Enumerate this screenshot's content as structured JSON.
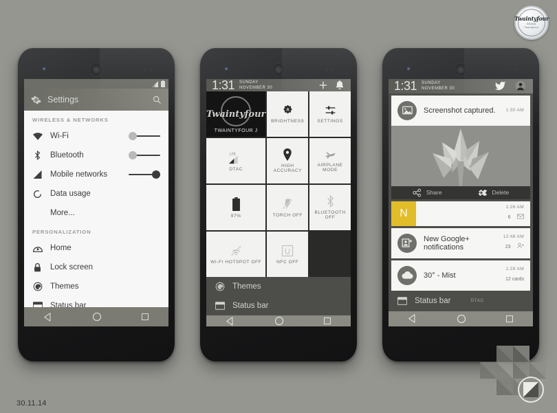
{
  "background_color": "#969691",
  "date_caption": "30.11.14",
  "brand_badge": {
    "word": "Twaintyfour",
    "sub_line1": "BRAND",
    "sub_line2": "Twaintyfour"
  },
  "corner_logo": {
    "name": "octagon-logo",
    "badge_name": "circle-slash-badge"
  },
  "phone1": {
    "name": "settings-app",
    "statusbar": {
      "signal_icon": "signal-icon",
      "battery_icon": "battery-icon"
    },
    "header": {
      "title": "Settings",
      "gear_icon": "gear-icon",
      "search_icon": "search-icon"
    },
    "sections": [
      {
        "label": "WIRELESS & NETWORKS",
        "rows": [
          {
            "icon": "wifi-icon",
            "label": "Wi-Fi",
            "toggle": "off"
          },
          {
            "icon": "bluetooth-icon",
            "label": "Bluetooth",
            "toggle": "off"
          },
          {
            "icon": "signal-icon",
            "label": "Mobile networks",
            "toggle": "on"
          },
          {
            "icon": "data-usage-icon",
            "label": "Data usage",
            "toggle": "none"
          },
          {
            "icon": "",
            "label": "More...",
            "toggle": "none"
          }
        ]
      },
      {
        "label": "PERSONALIZATION",
        "rows": [
          {
            "icon": "home-icon",
            "label": "Home",
            "toggle": "none"
          },
          {
            "icon": "lock-icon",
            "label": "Lock screen",
            "toggle": "none"
          },
          {
            "icon": "themes-icon",
            "label": "Themes",
            "toggle": "none"
          },
          {
            "icon": "status-bar-icon",
            "label": "Status bar",
            "toggle": "none"
          }
        ]
      }
    ],
    "navbar": {
      "back": "back-icon",
      "home": "home-circle-icon",
      "recents": "recents-icon"
    }
  },
  "phone2": {
    "name": "quick-settings-panel",
    "statusbar": {
      "time": "1:31",
      "date_line1": "SUNDAY",
      "date_line2": "NOVEMBER 30",
      "add_icon": "plus-icon",
      "bell_icon": "bell-icon"
    },
    "tiles": [
      {
        "kind": "user",
        "icon": "user-avatar-logo",
        "label": "TWAINTYFOUR J",
        "logo_word": "Twaintyfour"
      },
      {
        "kind": "tile",
        "icon": "brightness-auto-icon",
        "label": "BRIGHTNESS"
      },
      {
        "kind": "tile",
        "icon": "sliders-icon",
        "label": "SETTINGS"
      },
      {
        "kind": "tile",
        "icon": "lte-signal-icon",
        "label": "DTAC",
        "badge": "LTE"
      },
      {
        "kind": "tile",
        "icon": "location-pin-icon",
        "label": "HIGH ACCURACY"
      },
      {
        "kind": "tile",
        "icon": "airplane-icon",
        "label": "AIRPLANE MODE"
      },
      {
        "kind": "tile",
        "icon": "battery-full-icon",
        "label": "97%"
      },
      {
        "kind": "tile",
        "icon": "torch-off-icon",
        "label": "TORCH OFF"
      },
      {
        "kind": "tile",
        "icon": "bluetooth-off-icon",
        "label": "BLUETOOTH OFF"
      },
      {
        "kind": "tile",
        "icon": "hotspot-off-icon",
        "label": "WI-FI HOTSPOT OFF"
      },
      {
        "kind": "tile",
        "icon": "nfc-off-icon",
        "label": "NFC OFF"
      },
      {
        "kind": "empty",
        "icon": "",
        "label": ""
      }
    ],
    "underlay_rows": [
      {
        "icon": "themes-icon",
        "label": "Themes"
      },
      {
        "icon": "status-bar-icon",
        "label": "Status bar"
      }
    ],
    "navbar": {
      "back": "back-icon",
      "home": "home-circle-icon",
      "recents": "recents-icon"
    }
  },
  "phone3": {
    "name": "notification-shade",
    "statusbar": {
      "time": "1:31",
      "date_line1": "SUNDAY",
      "date_line2": "NOVEMBER 30",
      "bird_icon": "bird-icon",
      "avatar_icon": "user-avatar-icon"
    },
    "screenshot_notification": {
      "icon": "image-icon",
      "title": "Screenshot captured.",
      "time": "1:30 AM",
      "preview": "leaf-wallpaper-thumbnail"
    },
    "actions": [
      {
        "icon": "share-icon",
        "label": "Share"
      },
      {
        "icon": "delete-icon",
        "label": "Delete"
      }
    ],
    "notifications": [
      {
        "style": "yellow-tile",
        "tile_letter": "N",
        "tile_color": "#e0bd29",
        "title": "",
        "time": "1:26 AM",
        "count": "6",
        "count_icon": "envelope-icon"
      },
      {
        "style": "avatar",
        "icon": "google-plus-icon",
        "title": "New Google+ notifications",
        "time": "12:48 AM",
        "count": "23",
        "count_icon": "person-add-icon"
      },
      {
        "style": "avatar",
        "icon": "cloud-icon",
        "title": "30° - Mist",
        "time": "1:28 AM",
        "count": "12 cards",
        "count_icon": ""
      }
    ],
    "underlay_rows": [
      {
        "icon": "status-bar-icon",
        "label": "Status bar",
        "extra": "DTAC"
      }
    ],
    "navbar": {
      "back": "back-icon",
      "home": "home-circle-icon",
      "recents": "recents-icon"
    }
  }
}
